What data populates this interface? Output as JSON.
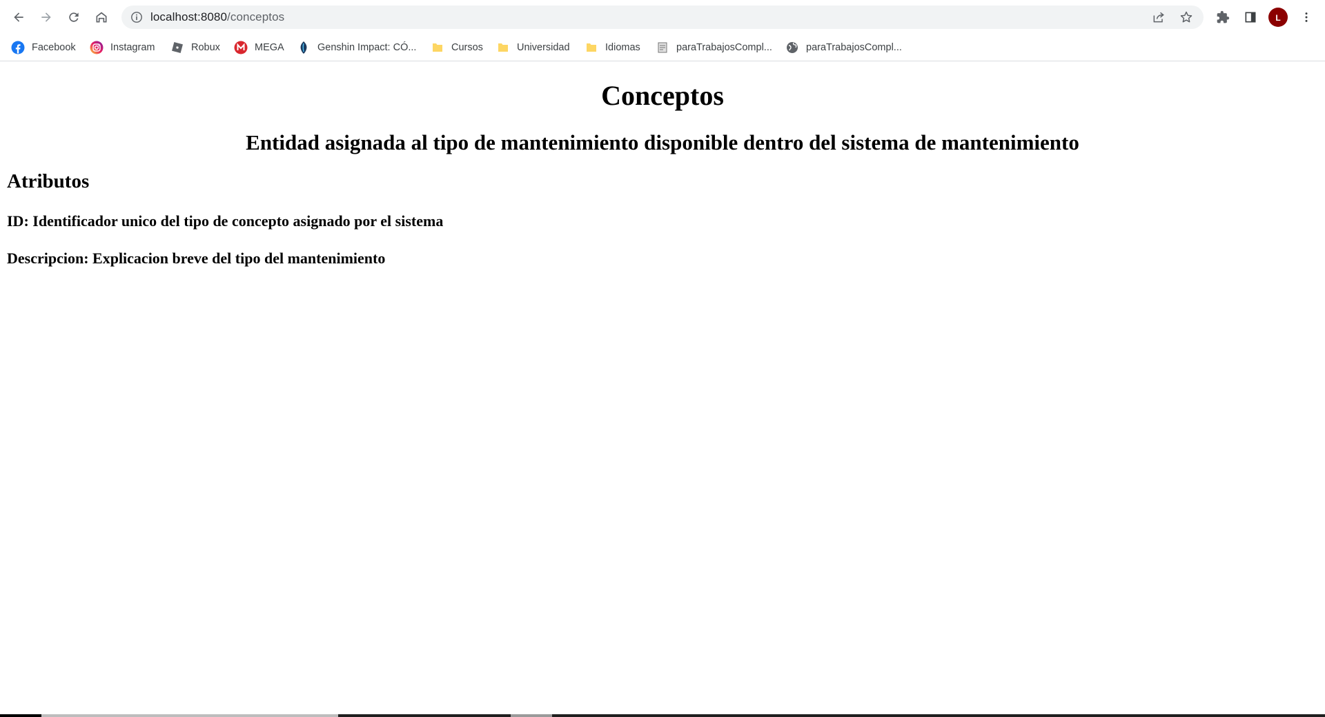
{
  "browser": {
    "url_host": "localhost:8080",
    "url_path": "/conceptos",
    "avatar_letter": "L",
    "avatar_color": "#8b0000",
    "bookmarks": [
      {
        "label": "Facebook",
        "icon": "facebook-icon"
      },
      {
        "label": "Instagram",
        "icon": "instagram-icon"
      },
      {
        "label": "Robux",
        "icon": "robux-icon"
      },
      {
        "label": "MEGA",
        "icon": "mega-icon"
      },
      {
        "label": "Genshin Impact: CÓ...",
        "icon": "genshin-icon"
      },
      {
        "label": "Cursos",
        "icon": "folder-icon"
      },
      {
        "label": "Universidad",
        "icon": "folder-icon"
      },
      {
        "label": "Idiomas",
        "icon": "folder-icon"
      },
      {
        "label": "paraTrabajosCompl...",
        "icon": "document-icon"
      },
      {
        "label": "paraTrabajosCompl...",
        "icon": "globe-icon"
      }
    ]
  },
  "page": {
    "title": "Conceptos",
    "subtitle": "Entidad asignada al tipo de mantenimiento disponible dentro del sistema de mantenimiento",
    "attributes_heading": "Atributos",
    "attributes": [
      "ID: Identificador unico del tipo de concepto asignado por el sistema",
      "Descripcion: Explicacion breve del tipo del mantenimiento"
    ]
  }
}
